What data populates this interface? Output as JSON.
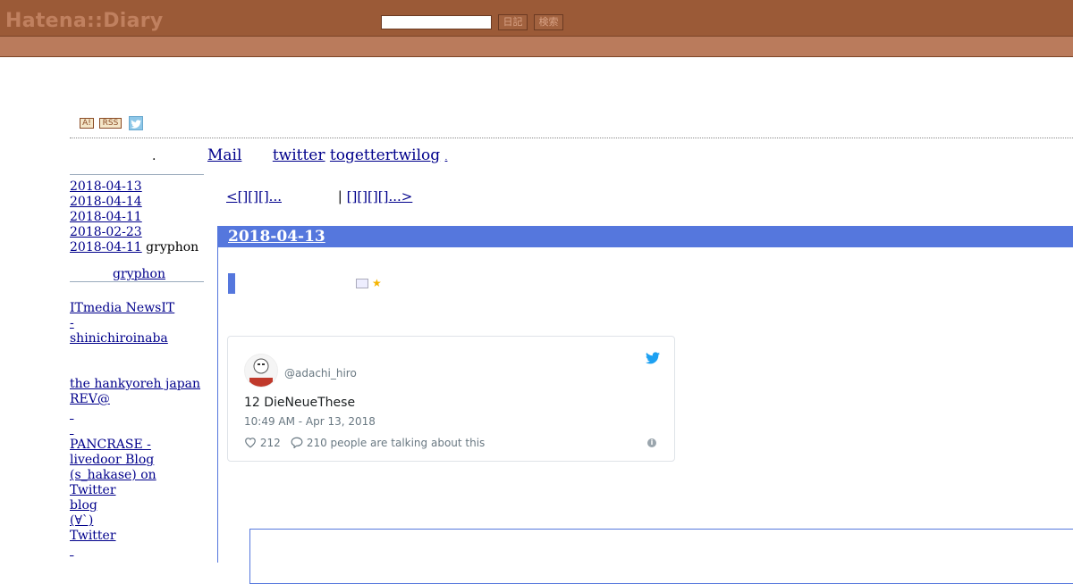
{
  "header": {
    "logo": "Hatena::Diary",
    "search_placeholder": "",
    "diary_button": "日記",
    "search_button": "検索"
  },
  "badges": {
    "antenna": "A!",
    "rss": "RSS"
  },
  "nav": {
    "dot": ".",
    "links": [
      "Mail",
      "twitter",
      "togettertwilog",
      "."
    ]
  },
  "sidebar": {
    "recent": [
      {
        "date": "2018-04-13",
        "extra": ""
      },
      {
        "date": "2018-04-14",
        "extra": ""
      },
      {
        "date": "2018-04-11",
        "extra": ""
      },
      {
        "date": "2018-02-23",
        "extra": ""
      },
      {
        "date": "2018-04-11",
        "extra": " gryphon"
      }
    ],
    "profile": "gryphon",
    "links": [
      "ITmedia NewsIT",
      "-",
      "shinichiroinaba",
      "the hankyoreh japan",
      "REV@",
      "",
      "",
      "PANCRASE -",
      "livedoor Blog",
      "(s_hakase) on",
      "Twitter",
      "blog",
      "(∀`)",
      "Twitter",
      ""
    ]
  },
  "pager": {
    "prev": "<[][][]...",
    "sep": "|",
    "next": "[][][][]...>"
  },
  "entry": {
    "date": "2018-04-13",
    "tweet": {
      "handle": "@adachi_hiro",
      "text": "12 DieNeueThese",
      "time": "10:49 AM - Apr 13, 2018",
      "likes": "212",
      "talking": "210 people are talking about this"
    }
  },
  "colors": {
    "header_bg": "#9b5a37",
    "subbar_bg": "#ba7b5c",
    "accent_blue": "#5577dd",
    "link": "#00008b",
    "twitter_blue": "#1da1f2"
  }
}
